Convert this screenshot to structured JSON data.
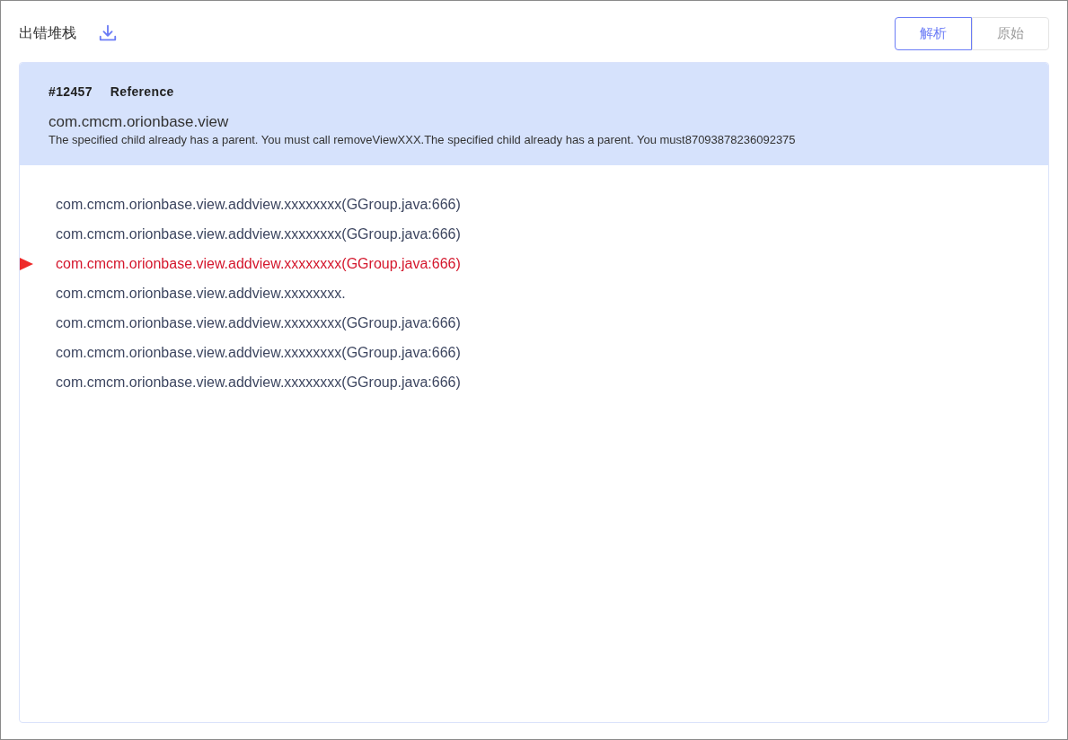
{
  "header": {
    "title": "出错堆栈"
  },
  "view_toggle": [
    {
      "label": "解析",
      "selected": true
    },
    {
      "label": "原始",
      "selected": false
    }
  ],
  "summary": {
    "id": "#12457",
    "type": "Reference",
    "package": "com.cmcm.orionbase.view",
    "message": "The specified child already has a parent. You must call removeViewXXX.The specified child already has a parent. You must87093878236092375"
  },
  "frames": [
    {
      "text": "com.cmcm.orionbase.view.addview.xxxxxxxx(GGroup.java:666)",
      "selected": false
    },
    {
      "text": "com.cmcm.orionbase.view.addview.xxxxxxxx(GGroup.java:666)",
      "selected": false
    },
    {
      "text": "com.cmcm.orionbase.view.addview.xxxxxxxx(GGroup.java:666)",
      "selected": true
    },
    {
      "text": "com.cmcm.orionbase.view.addview.xxxxxxxx.",
      "selected": false
    },
    {
      "text": "com.cmcm.orionbase.view.addview.xxxxxxxx(GGroup.java:666)",
      "selected": false
    },
    {
      "text": "com.cmcm.orionbase.view.addview.xxxxxxxx(GGroup.java:666)",
      "selected": false
    },
    {
      "text": "com.cmcm.orionbase.view.addview.xxxxxxxx(GGroup.java:666)",
      "selected": false
    }
  ]
}
